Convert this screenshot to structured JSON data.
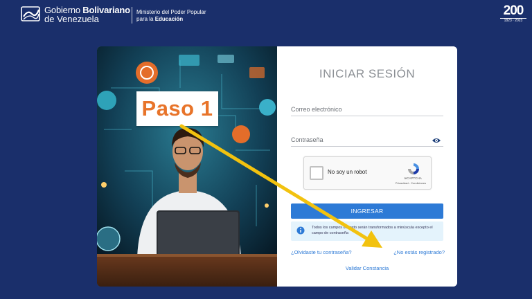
{
  "header": {
    "gov_line1_a": "Gobierno ",
    "gov_line1_b": "Bolivariano",
    "gov_line2": "de Venezuela",
    "ministry_line1": "Ministerio del Poder Popular",
    "ministry_line2_a": "para la ",
    "ministry_line2_b": "Educación",
    "anniv_num": "200",
    "anniv_sub": "1823 · 2023"
  },
  "login": {
    "title": "INICIAR SESIÓN",
    "email_placeholder": "Correo electrónico",
    "password_placeholder": "Contraseña",
    "captcha_label": "No soy un robot",
    "captcha_brand": "reCAPTCHA",
    "captcha_links": "Privacidad - Condiciones",
    "submit_label": "INGRESAR",
    "notice": "Todos los campos de texto serán transformados a minúscula excepto el campo de contraseña",
    "forgot_link": "¿Olvidaste tu contraseña?",
    "register_link": "¿No estás registrado?",
    "validate_link": "Validar Constancia"
  },
  "overlay": {
    "step_label": "Paso 1"
  },
  "colors": {
    "background": "#1a2f6b",
    "primary": "#2d7ad6",
    "step_text": "#e8742a",
    "arrow": "#f2c20f"
  },
  "icons": [
    "gov-flag-icon",
    "eye-icon",
    "recaptcha-icon",
    "info-icon",
    "arrow-annotation-icon"
  ]
}
